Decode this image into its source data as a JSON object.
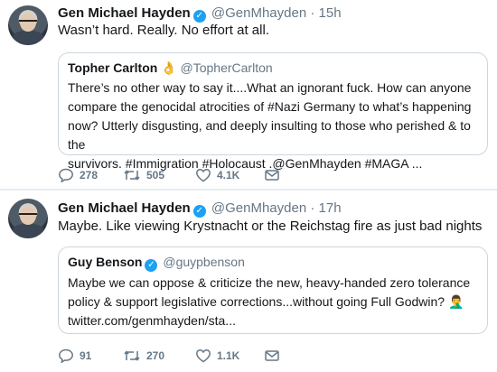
{
  "tweets": [
    {
      "name": "Gen Michael Hayden",
      "handle": "@GenMhayden",
      "time": "· 15h",
      "text": "Wasn’t hard. Really.   No effort at all.",
      "quote": {
        "name": "Topher Carlton",
        "badge": "👌",
        "handle": "@TopherCarlton",
        "lines": [
          "There’s no other way to say it....What an ignorant fuck. How can anyone",
          "compare the genocidal atrocities of #Nazi Germany to what’s happening",
          "now? Utterly disgusting, and deeply insulting to those who perished & to the",
          "survivors. #Immigration #Holocaust .@GenMhayden #MAGA ..."
        ]
      },
      "replies": "278",
      "retweets": "505",
      "likes": "4.1K"
    },
    {
      "name": "Gen Michael Hayden",
      "handle": "@GenMhayden",
      "time": "· 17h",
      "text": "Maybe.   Like viewing Krystnacht or the Reichstag fire as just bad nights",
      "quote": {
        "name": "Guy Benson",
        "handle": "@guypbenson",
        "lines": [
          "Maybe we can oppose & criticize the new, heavy-handed zero tolerance",
          "policy & support legislative corrections...without going Full Godwin? 🤦‍♂️",
          "twitter.com/genmhayden/sta..."
        ]
      },
      "replies": "91",
      "retweets": "270",
      "likes": "1.1K"
    }
  ],
  "colors": {
    "verified": "#1da1f2",
    "muted": "#657786",
    "border": "#ccd6dd"
  },
  "icons": [
    "reply-icon",
    "retweet-icon",
    "like-icon",
    "message-icon",
    "verified-icon"
  ]
}
